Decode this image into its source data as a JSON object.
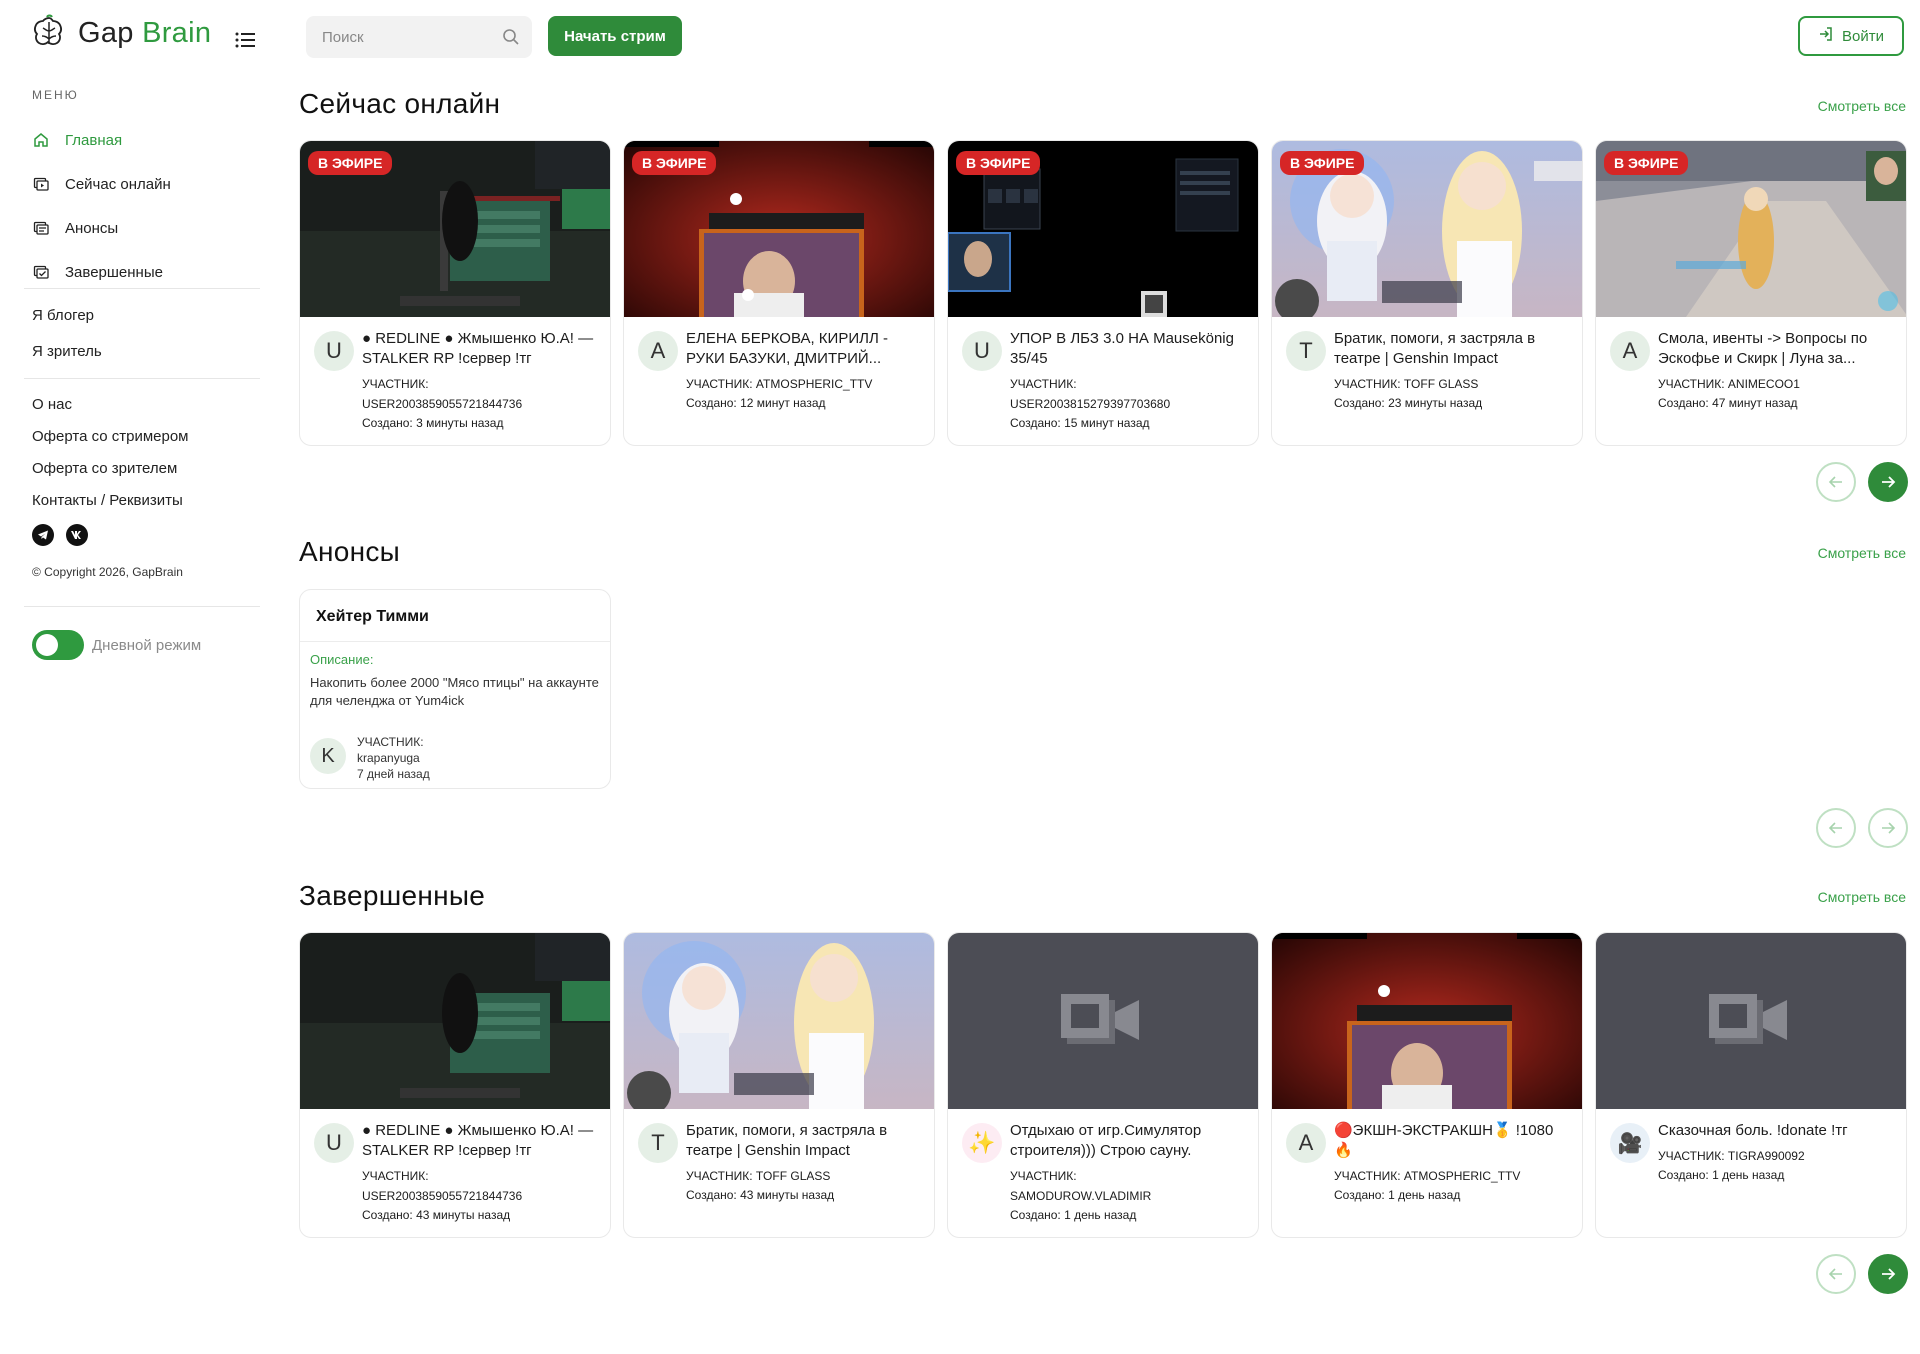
{
  "brand": {
    "name_part1": "Gap ",
    "name_part2": "Brain",
    "accent": "#2f9a3f"
  },
  "sidebar": {
    "menu_caption": "МЕНЮ",
    "items": [
      {
        "label": "Главная",
        "icon": "home-icon",
        "active": true
      },
      {
        "label": "Сейчас онлайн",
        "icon": "live-tv-icon",
        "active": false
      },
      {
        "label": "Анонсы",
        "icon": "announcement-icon",
        "active": false
      },
      {
        "label": "Завершенные",
        "icon": "finished-icon",
        "active": false
      }
    ],
    "role_links": [
      "Я блогер",
      "Я зритель"
    ],
    "info_links": [
      "О нас",
      "Оферта со стримером",
      "Оферта со зрителем",
      "Контакты / Реквизиты"
    ],
    "socials": [
      "telegram-icon",
      "vk-icon"
    ],
    "copyright": "© Copyright 2026, GapBrain",
    "theme_label": "Дневной режим"
  },
  "header": {
    "search_placeholder": "Поиск",
    "stream_button": "Начать стрим",
    "login_button": "Войти"
  },
  "online": {
    "title": "Сейчас онлайн",
    "see_all": "Смотреть все",
    "live_badge": "В ЭФИРЕ",
    "cards": [
      {
        "avatar": "U",
        "title": "● REDLINE ● Жмышенко Ю.А! — STALKER RP !сервер !тг",
        "participant_label": "УЧАСТНИК:",
        "participant": "USER2003859055721844736",
        "created": "Создано: 3 минуты назад"
      },
      {
        "avatar": "A",
        "title": "ЕЛЕНА БЕРКОВА, КИРИЛЛ - РУКИ БАЗУКИ, ДМИТРИЙ...",
        "participant_label": "УЧАСТНИК:",
        "participant": "ATMOSPHERIC_TTV",
        "created": "Создано: 12 минут назад"
      },
      {
        "avatar": "U",
        "title": "УПОР В ЛБЗ 3.0 НА Mausekönig 35/45",
        "participant_label": "УЧАСТНИК:",
        "participant": "USER2003815279397703680",
        "created": "Создано: 15 минут назад"
      },
      {
        "avatar": "T",
        "title": "Братик, помоги, я застряла в театре | Genshin Impact",
        "participant_label": "УЧАСТНИК:",
        "participant": "TOFF GLASS",
        "created": "Создано: 23 минуты назад"
      },
      {
        "avatar": "A",
        "title": "Смола, ивенты -> Вопросы по Эскофье и Скирк | Луна за...",
        "participant_label": "УЧАСТНИК:",
        "participant": "ANIMECOO1",
        "created": "Создано: 47 минут назад"
      }
    ]
  },
  "anons": {
    "title": "Анонсы",
    "see_all": "Смотреть все",
    "card": {
      "title": "Хейтер Тимми",
      "desc_label": "Описание:",
      "desc": "Накопить более 2000 \"Мясо птицы\" на аккаунте для челенджа от Yum4ick",
      "avatar": "K",
      "participant_label": "УЧАСТНИК:",
      "participant": "krapanyuga",
      "time": "7 дней назад"
    }
  },
  "finished": {
    "title": "Завершенные",
    "see_all": "Смотреть все",
    "cards": [
      {
        "avatar": "U",
        "title": "● REDLINE ● Жмышенко Ю.А! — STALKER RP !сервер !тг",
        "participant_label": "УЧАСТНИК:",
        "participant": "USER2003859055721844736",
        "created": "Создано: 43 минуты назад"
      },
      {
        "avatar": "T",
        "title": "Братик, помоги, я застряла в театре | Genshin Impact",
        "participant_label": "УЧАСТНИК:",
        "participant": "TOFF GLASS",
        "created": "Создано: 43 минуты назад"
      },
      {
        "avatar": "✨",
        "title": "Отдыхаю от игр.Симулятор строителя))) Строю сауну.",
        "participant_label": "УЧАСТНИК:",
        "participant": "SAMODUROW.VLADIMIR",
        "created": "Создано: 1 день назад"
      },
      {
        "avatar": "A",
        "title": "🔴ЭКШН-ЭКСТРАКШН🥇 !1080 🔥",
        "participant_label": "УЧАСТНИК:",
        "participant": "ATMOSPHERIC_TTV",
        "created": "Создано: 1 день назад"
      },
      {
        "avatar": "🎥",
        "title": "Сказочная боль. !donate !тг",
        "participant_label": "УЧАСТНИК:",
        "participant": "TIGRA990092",
        "created": "Создано: 1 день назад"
      }
    ]
  }
}
